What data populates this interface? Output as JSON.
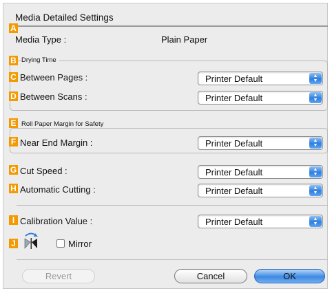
{
  "dialog": {
    "title": "Media Detailed Settings"
  },
  "badges": {
    "a": "A",
    "b": "B",
    "c": "C",
    "d": "D",
    "e": "E",
    "f": "F",
    "g": "G",
    "h": "H",
    "i": "I",
    "j": "J"
  },
  "media_type": {
    "label": "Media Type :",
    "value": "Plain Paper"
  },
  "drying_time": {
    "section": "Drying Time",
    "between_pages": {
      "label": "Between Pages :",
      "value": "Printer Default"
    },
    "between_scans": {
      "label": "Between Scans :",
      "value": "Printer Default"
    }
  },
  "roll_paper_margin": {
    "section": "Roll Paper Margin for Safety",
    "near_end_margin": {
      "label": "Near End Margin :",
      "value": "Printer Default"
    }
  },
  "cut_speed": {
    "label": "Cut Speed :",
    "value": "Printer Default"
  },
  "automatic_cutting": {
    "label": "Automatic Cutting :",
    "value": "Printer Default"
  },
  "calibration_value": {
    "label": "Calibration Value :",
    "value": "Printer Default"
  },
  "mirror": {
    "label": "Mirror",
    "checked": false
  },
  "buttons": {
    "revert": "Revert",
    "cancel": "Cancel",
    "ok": "OK"
  },
  "colors": {
    "badge": "#f39a00",
    "accent": "#2f7fe0"
  },
  "icons": {
    "select_arrows": "up-down-arrows-icon",
    "mirror": "mirror-icon"
  }
}
